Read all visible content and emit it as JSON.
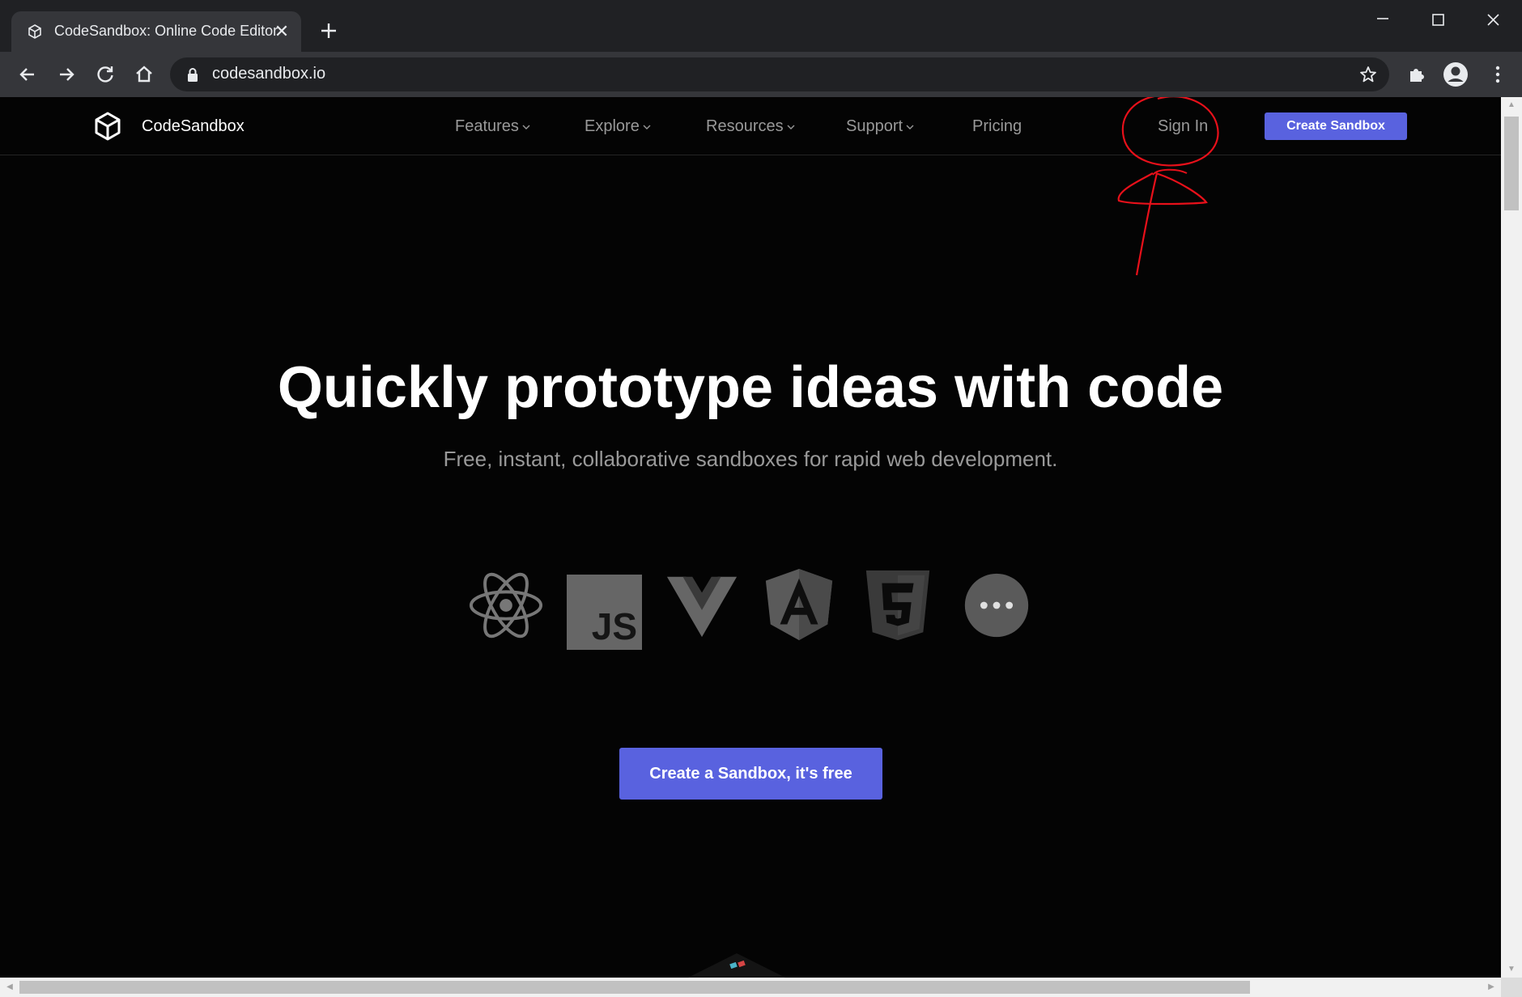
{
  "browser": {
    "tab_title": "CodeSandbox: Online Code Editor and IDE for Rapid Web Development",
    "tab_close": "✕",
    "url": "codesandbox.io"
  },
  "nav": {
    "brand": "CodeSandbox",
    "items": [
      {
        "label": "Features"
      },
      {
        "label": "Explore"
      },
      {
        "label": "Resources"
      },
      {
        "label": "Support"
      },
      {
        "label": "Pricing"
      }
    ],
    "sign_in": "Sign In",
    "create_button": "Create Sandbox"
  },
  "hero": {
    "title": "Quickly prototype ideas with code",
    "subtitle": "Free, instant, collaborative sandboxes for rapid web development.",
    "cta": "Create a Sandbox, it's free",
    "templates": [
      "react-icon",
      "javascript-icon",
      "vue-icon",
      "angular-icon",
      "html5-icon",
      "more-icon"
    ],
    "js_label": "JS"
  },
  "colors": {
    "accent": "#5962df",
    "annotation": "#e8101a",
    "background": "#040404"
  }
}
